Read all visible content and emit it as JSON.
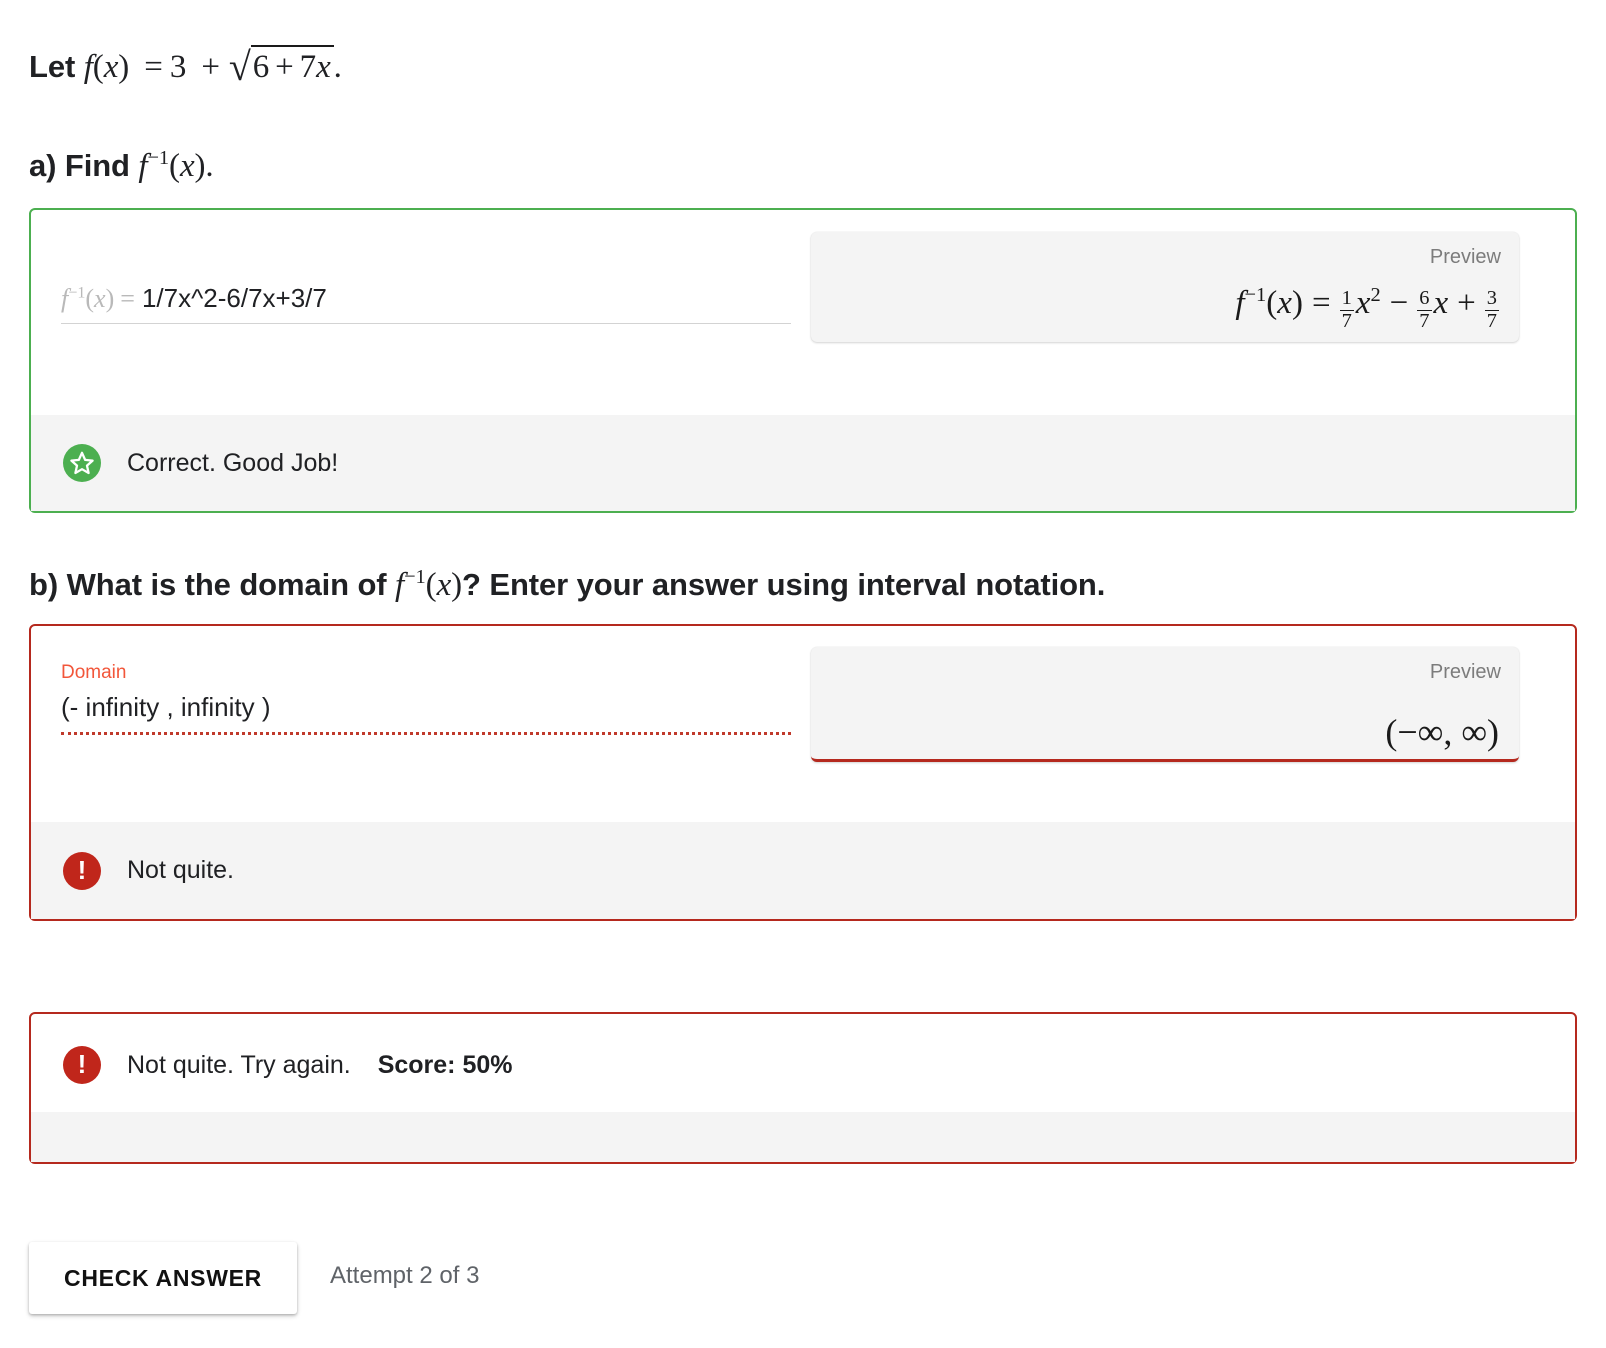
{
  "stem": {
    "lead": "Let",
    "function_text": "f(x) = 3 + sqrt(6 + 7x).",
    "fn_name": "f",
    "open_paren": "(",
    "var": "x",
    "close_paren": ")",
    "equals": "=",
    "constant": "3",
    "plus": "+",
    "radicand_a": "6",
    "radicand_b": "7",
    "period": "."
  },
  "part_a": {
    "label_prefix": "a) Find",
    "label_fn": "f",
    "label_exp": "−1",
    "label_suffix": "(x).",
    "input": {
      "prefix_plain": "f−1(x) =",
      "value": "1/7x^2-6/7x+3/7",
      "placeholder": ""
    },
    "preview": {
      "label": "Preview",
      "plain": "f−1(x) = 1/7 x² − 6/7 x + 3/7",
      "terms": {
        "coef1_num": "1",
        "coef1_den": "7",
        "coef2_num": "6",
        "coef2_den": "7",
        "coef3_num": "3",
        "coef3_den": "7",
        "power": "2",
        "op_minus": "−",
        "op_plus": "+"
      }
    },
    "feedback": {
      "icon": "star-icon",
      "text": "Correct. Good Job!",
      "state": "correct",
      "color": "#4CAF50"
    }
  },
  "part_b": {
    "label": "b) What is the domain of",
    "label_fn": "f",
    "label_exp": "−1",
    "label_mid": "(x)? Enter your answer using interval notation.",
    "input": {
      "float_label": "Domain",
      "value": "(- infinity , infinity )",
      "placeholder": ""
    },
    "preview": {
      "label": "Preview",
      "math": "(−∞, ∞)"
    },
    "feedback": {
      "icon": "exclamation-icon",
      "text": "Not quite.",
      "state": "incorrect",
      "color": "#C0261B"
    }
  },
  "result": {
    "icon": "exclamation-icon",
    "message": "Not quite. Try again.",
    "score_label": "Score: 50%",
    "state": "incorrect"
  },
  "actions": {
    "check_answer": "CHECK ANSWER",
    "attempt": "Attempt 2 of 3"
  },
  "colors": {
    "correct": "#4CAF50",
    "incorrect": "#B5291E",
    "error_label": "#F2563A",
    "preview_bg": "#f4f4f4",
    "text": "#202124"
  }
}
